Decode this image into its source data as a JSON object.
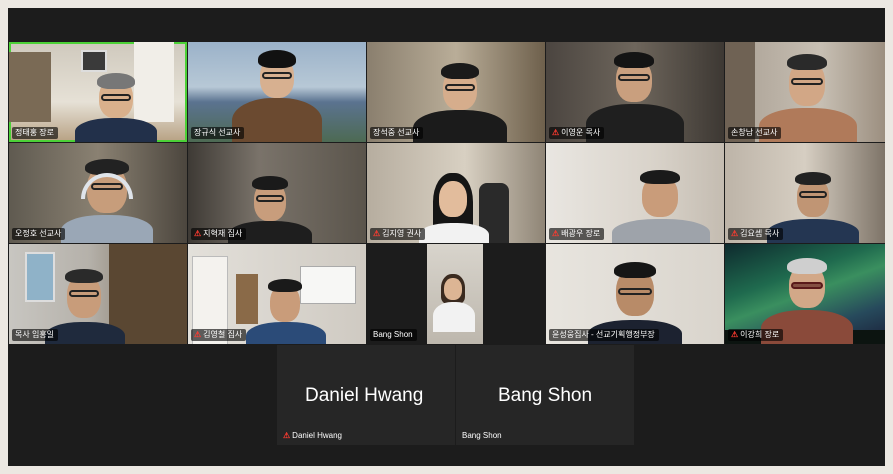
{
  "participants": [
    {
      "name": "정태홍 장로",
      "muted": false
    },
    {
      "name": "장규식 선교사",
      "muted": false
    },
    {
      "name": "장석중 선교사",
      "muted": false
    },
    {
      "name": "이영운 목사",
      "muted": true
    },
    {
      "name": "손창남 선교사",
      "muted": false
    },
    {
      "name": "오정호 선교사",
      "muted": false
    },
    {
      "name": "지혁재 집사",
      "muted": true
    },
    {
      "name": "김지영 권사",
      "muted": true
    },
    {
      "name": "배광우 장로",
      "muted": true
    },
    {
      "name": "김요셉 목사",
      "muted": true
    },
    {
      "name": "목사 임홍일",
      "muted": false
    },
    {
      "name": "김영철 집사",
      "muted": true
    },
    {
      "name": "Bang Shon",
      "muted": false
    },
    {
      "name": "윤성웅집사 - 선교기획행정부장",
      "muted": false
    },
    {
      "name": "이강희 장로",
      "muted": true
    }
  ],
  "no_video": [
    {
      "display_name": "Daniel Hwang",
      "tag": "Daniel Hwang",
      "muted": true
    },
    {
      "display_name": "Bang Shon",
      "tag": "Bang Shon",
      "muted": false
    }
  ],
  "colors": {
    "active_speaker": "#4cd137",
    "muted_icon": "#ff3b30",
    "background": "#1c1c1c"
  },
  "icons": {
    "muted": "mic-off-icon"
  }
}
